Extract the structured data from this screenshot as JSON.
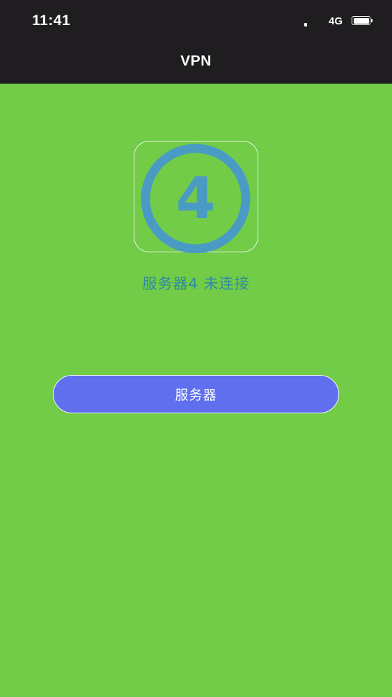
{
  "status_bar": {
    "time": "11:41",
    "network": "4G",
    "icons": [
      "signal-icon",
      "battery-icon"
    ]
  },
  "nav": {
    "title": "VPN"
  },
  "server": {
    "number": "4",
    "status_text": "服务器4 未连接",
    "button_label": "服务器"
  },
  "colors": {
    "background": "#72cc47",
    "bars": "#1f1d20",
    "icon_ring": "#4a9bc4",
    "status_text": "#2f8aa4",
    "button": "#5f6fed"
  }
}
